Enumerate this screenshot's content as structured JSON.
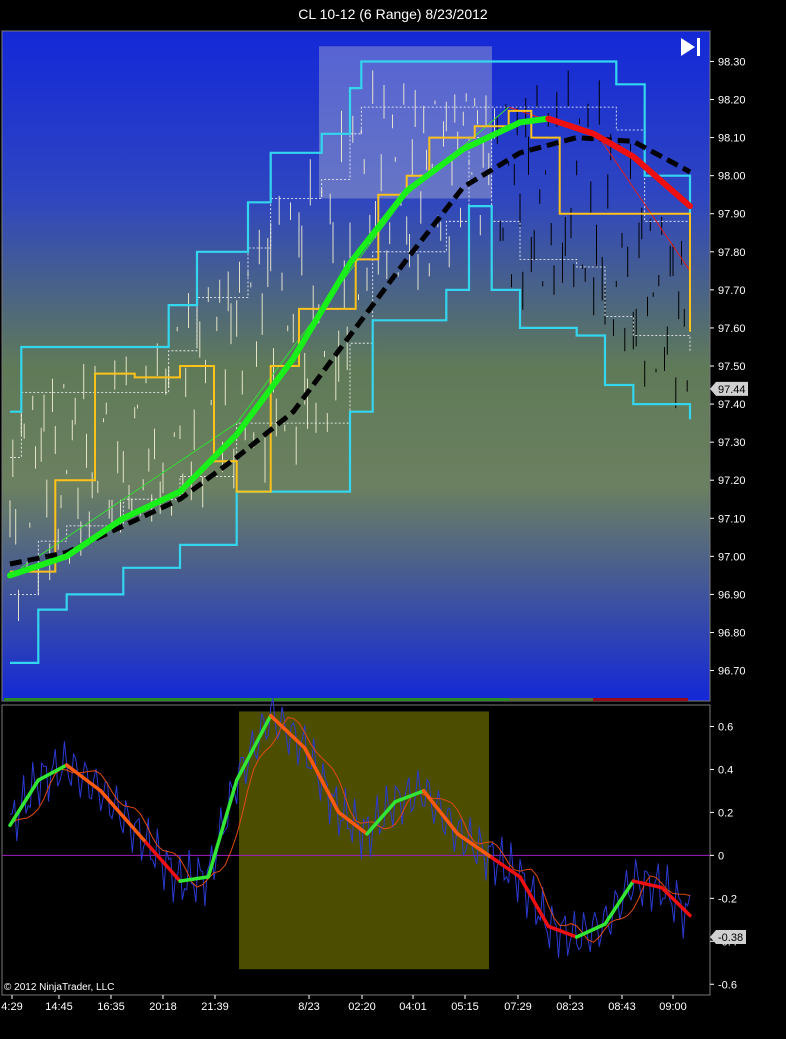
{
  "window": {
    "title": "CL 10-12 (6 Range)  8/23/2012"
  },
  "copyright": "© 2012 NinjaTrader, LLC",
  "play_icon": "play-to-end-icon",
  "colors": {
    "panel_top": "#1428d8",
    "panel_mid": "#5f7a58",
    "cyan_channel": "#33d6ee",
    "orange_channel": "#ffc21a",
    "hma_up": "#19f019",
    "hma_down": "#ee1010",
    "dashed_ma": "#000000",
    "oscillator_up": "#33e633",
    "oscillator_down": "#ff5a10",
    "zero_line": "#a020c0",
    "highlight_box": "#5a5a00"
  },
  "chart_data": [
    {
      "type": "line",
      "name": "price-panel",
      "title": "CL 10-12 (6 Range)  8/23/2012",
      "x": [
        "4:29",
        "14:45",
        "16:35",
        "20:18",
        "21:39",
        "8/23",
        "02:20",
        "04:01",
        "05:15",
        "07:29",
        "08:23",
        "08:43",
        "09:00"
      ],
      "ylim": [
        96.62,
        98.38
      ],
      "yticks": [
        "96.70",
        "96.80",
        "96.90",
        "97.00",
        "97.10",
        "97.20",
        "97.30",
        "97.40",
        "97.50",
        "97.60",
        "97.70",
        "97.80",
        "97.90",
        "98.00",
        "98.10",
        "98.20",
        "98.30"
      ],
      "last_price": "97.44",
      "series": [
        {
          "role": "hma-solid",
          "points": [
            [
              0,
              96.95
            ],
            [
              1,
              97.0
            ],
            [
              2,
              97.1
            ],
            [
              3,
              97.17
            ],
            [
              4,
              97.32
            ],
            [
              5,
              97.52
            ],
            [
              6,
              97.77
            ],
            [
              7,
              97.96
            ],
            [
              8,
              98.07
            ],
            [
              9,
              98.14
            ],
            [
              9.5,
              98.15
            ],
            [
              10.3,
              98.11
            ],
            [
              11,
              98.05
            ],
            [
              12,
              97.92
            ]
          ]
        },
        {
          "role": "ma-dashed",
          "points": [
            [
              0,
              96.98
            ],
            [
              1,
              97.01
            ],
            [
              2,
              97.08
            ],
            [
              3,
              97.15
            ],
            [
              4,
              97.26
            ],
            [
              5,
              97.38
            ],
            [
              6,
              97.58
            ],
            [
              7,
              97.78
            ],
            [
              8,
              97.97
            ],
            [
              9,
              98.06
            ],
            [
              10,
              98.1
            ],
            [
              11,
              98.09
            ],
            [
              12,
              98.01
            ]
          ]
        },
        {
          "role": "cyan-upper",
          "points": [
            [
              0,
              97.38
            ],
            [
              0.2,
              97.55
            ],
            [
              2.5,
              97.55
            ],
            [
              2.8,
              97.66
            ],
            [
              3.3,
              97.8
            ],
            [
              4.2,
              97.93
            ],
            [
              4.6,
              98.06
            ],
            [
              5.5,
              98.11
            ],
            [
              6,
              98.23
            ],
            [
              6.2,
              98.3
            ],
            [
              8.9,
              98.3
            ],
            [
              9.5,
              98.3
            ],
            [
              10,
              98.3
            ],
            [
              10.7,
              98.24
            ],
            [
              11.2,
              98.0
            ],
            [
              12,
              97.9
            ]
          ]
        },
        {
          "role": "cyan-lower",
          "points": [
            [
              0,
              96.72
            ],
            [
              0.5,
              96.86
            ],
            [
              1,
              96.9
            ],
            [
              2,
              96.97
            ],
            [
              3,
              97.03
            ],
            [
              4,
              97.17
            ],
            [
              5.7,
              97.17
            ],
            [
              6,
              97.38
            ],
            [
              6.4,
              97.62
            ],
            [
              7,
              97.62
            ],
            [
              7.7,
              97.7
            ],
            [
              8.1,
              97.92
            ],
            [
              8.5,
              97.7
            ],
            [
              9,
              97.6
            ],
            [
              10,
              97.58
            ],
            [
              10.5,
              97.45
            ],
            [
              11,
              97.4
            ],
            [
              12,
              97.36
            ]
          ]
        },
        {
          "role": "orange-upper",
          "points": [
            [
              0,
              96.96
            ],
            [
              0.8,
              97.2
            ],
            [
              1.5,
              97.48
            ],
            [
              2.2,
              97.47
            ],
            [
              3,
              97.5
            ],
            [
              3.4,
              97.5
            ],
            [
              3.6,
              97.25
            ],
            [
              4,
              97.17
            ],
            [
              4.6,
              97.5
            ],
            [
              5.1,
              97.65
            ],
            [
              5.6,
              97.65
            ],
            [
              6.1,
              97.78
            ],
            [
              6.5,
              97.95
            ],
            [
              7,
              98.0
            ],
            [
              7.4,
              98.1
            ],
            [
              8.2,
              98.13
            ],
            [
              8.8,
              98.17
            ],
            [
              9.2,
              98.1
            ],
            [
              9.7,
              97.9
            ],
            [
              10.5,
              97.9
            ],
            [
              11.7,
              97.9
            ],
            [
              12,
              97.59
            ]
          ]
        }
      ]
    },
    {
      "type": "line",
      "name": "oscillator-panel",
      "x": [
        "4:29",
        "14:45",
        "16:35",
        "20:18",
        "21:39",
        "8/23",
        "02:20",
        "04:01",
        "05:15",
        "07:29",
        "08:23",
        "08:43",
        "09:00"
      ],
      "ylim": [
        -0.65,
        0.7
      ],
      "yticks": [
        "0.6",
        "0.4",
        "0.2",
        "0",
        "-0.2",
        "-0.4",
        "-0.6"
      ],
      "last_value": "-0.38",
      "series": [
        {
          "role": "smooth-thick",
          "points": [
            [
              0,
              0.14
            ],
            [
              0.5,
              0.35
            ],
            [
              1,
              0.42
            ],
            [
              1.6,
              0.3
            ],
            [
              2.4,
              0.06
            ],
            [
              3,
              -0.12
            ],
            [
              3.5,
              -0.1
            ],
            [
              4,
              0.35
            ],
            [
              4.6,
              0.65
            ],
            [
              5.2,
              0.5
            ],
            [
              5.8,
              0.2
            ],
            [
              6.3,
              0.1
            ],
            [
              6.8,
              0.25
            ],
            [
              7.3,
              0.3
            ],
            [
              7.9,
              0.1
            ],
            [
              8.5,
              -0.01
            ],
            [
              9,
              -0.1
            ],
            [
              9.5,
              -0.33
            ],
            [
              10,
              -0.38
            ],
            [
              10.5,
              -0.32
            ],
            [
              11,
              -0.12
            ],
            [
              11.5,
              -0.15
            ],
            [
              12,
              -0.28
            ]
          ]
        }
      ]
    }
  ]
}
